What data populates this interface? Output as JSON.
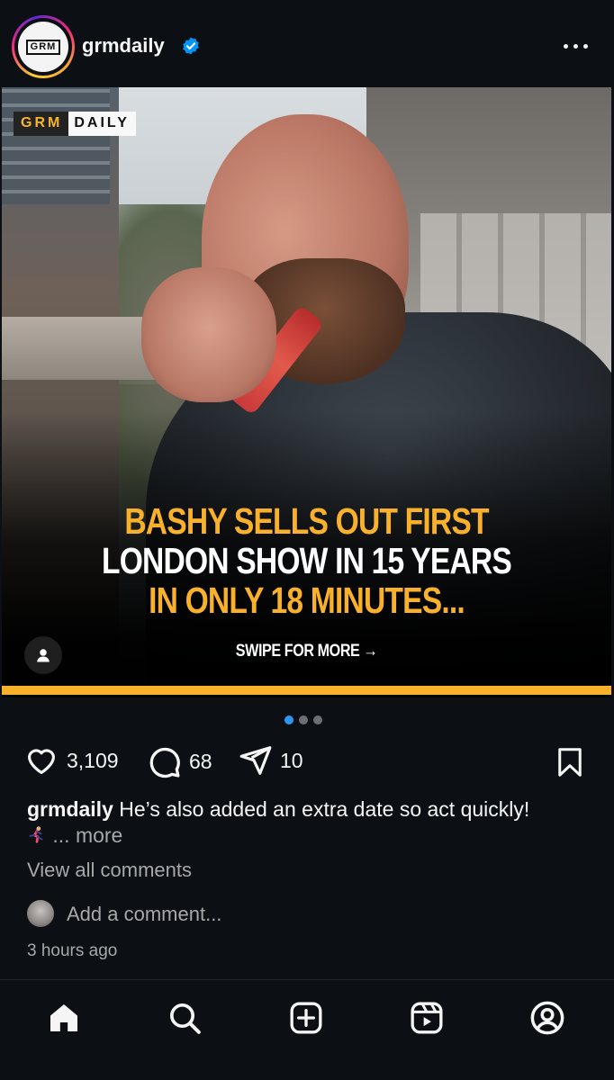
{
  "post": {
    "username": "grmdaily",
    "verified": true,
    "avatar_logo": "GRM",
    "menu_icon": "more-horizontal-icon"
  },
  "image": {
    "brand_left": "GRM",
    "brand_right": "DAILY",
    "headline_line1": "BASHY SELLS OUT FIRST",
    "headline_line2": "LONDON SHOW IN 15 YEARS",
    "headline_line3": "IN ONLY 18 MINUTES...",
    "swipe_text": "SWIPE FOR MORE →",
    "accent_color": "#f9b12b"
  },
  "carousel": {
    "total": 3,
    "active": 1
  },
  "actions": {
    "likes": "3,109",
    "comments": "68",
    "shares": "10"
  },
  "caption": {
    "user": "grmdaily",
    "text": "He’s also added an extra date so act quickly!",
    "ellipsis": "... more"
  },
  "comments": {
    "view_all": "View all comments",
    "add_placeholder": "Add a comment..."
  },
  "timestamp": "3 hours ago",
  "nav": {
    "items": [
      "home-icon",
      "search-icon",
      "create-icon",
      "reels-icon",
      "profile-icon"
    ]
  }
}
